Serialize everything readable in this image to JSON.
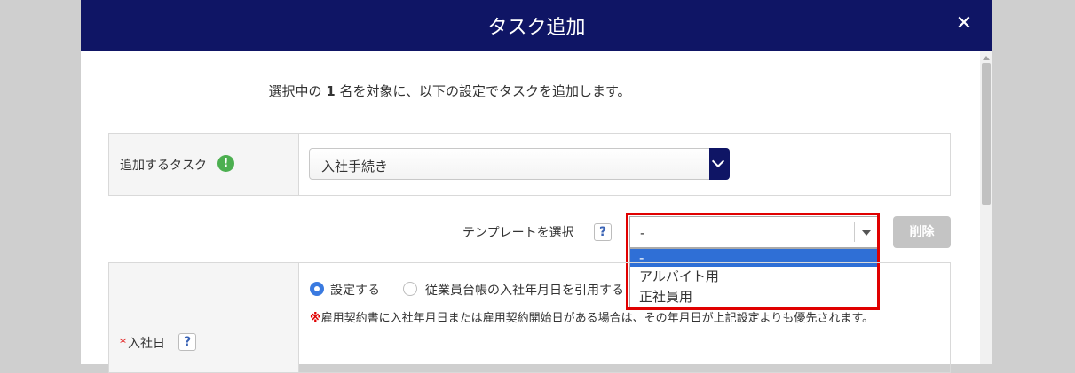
{
  "dialog": {
    "title": "タスク追加"
  },
  "intro": {
    "prefix": "選択中の",
    "count": "1",
    "suffix": "名を対象に、以下の設定でタスクを追加します。"
  },
  "task_row": {
    "label": "追加するタスク",
    "selected": "入社手続き"
  },
  "template": {
    "label": "テンプレートを選択",
    "value": "-",
    "options": [
      "-",
      "アルバイト用",
      "正社員用"
    ],
    "selected_index": 0,
    "delete_label": "削除"
  },
  "date_row": {
    "required_mark": "*",
    "label": "入社日",
    "options": [
      "設定する",
      "従業員台帳の入社年月日を引用する"
    ],
    "selected_index": 0,
    "note_mark": "※",
    "note": "雇用契約書に入社年月日または雇用契約開始日がある場合は、その年月日が上記設定よりも優先されます。"
  },
  "colors": {
    "header_bg": "#0f1565",
    "highlight": "#e00000",
    "selected_option_bg": "#2f6fd6",
    "info_icon": "#4caf50"
  }
}
